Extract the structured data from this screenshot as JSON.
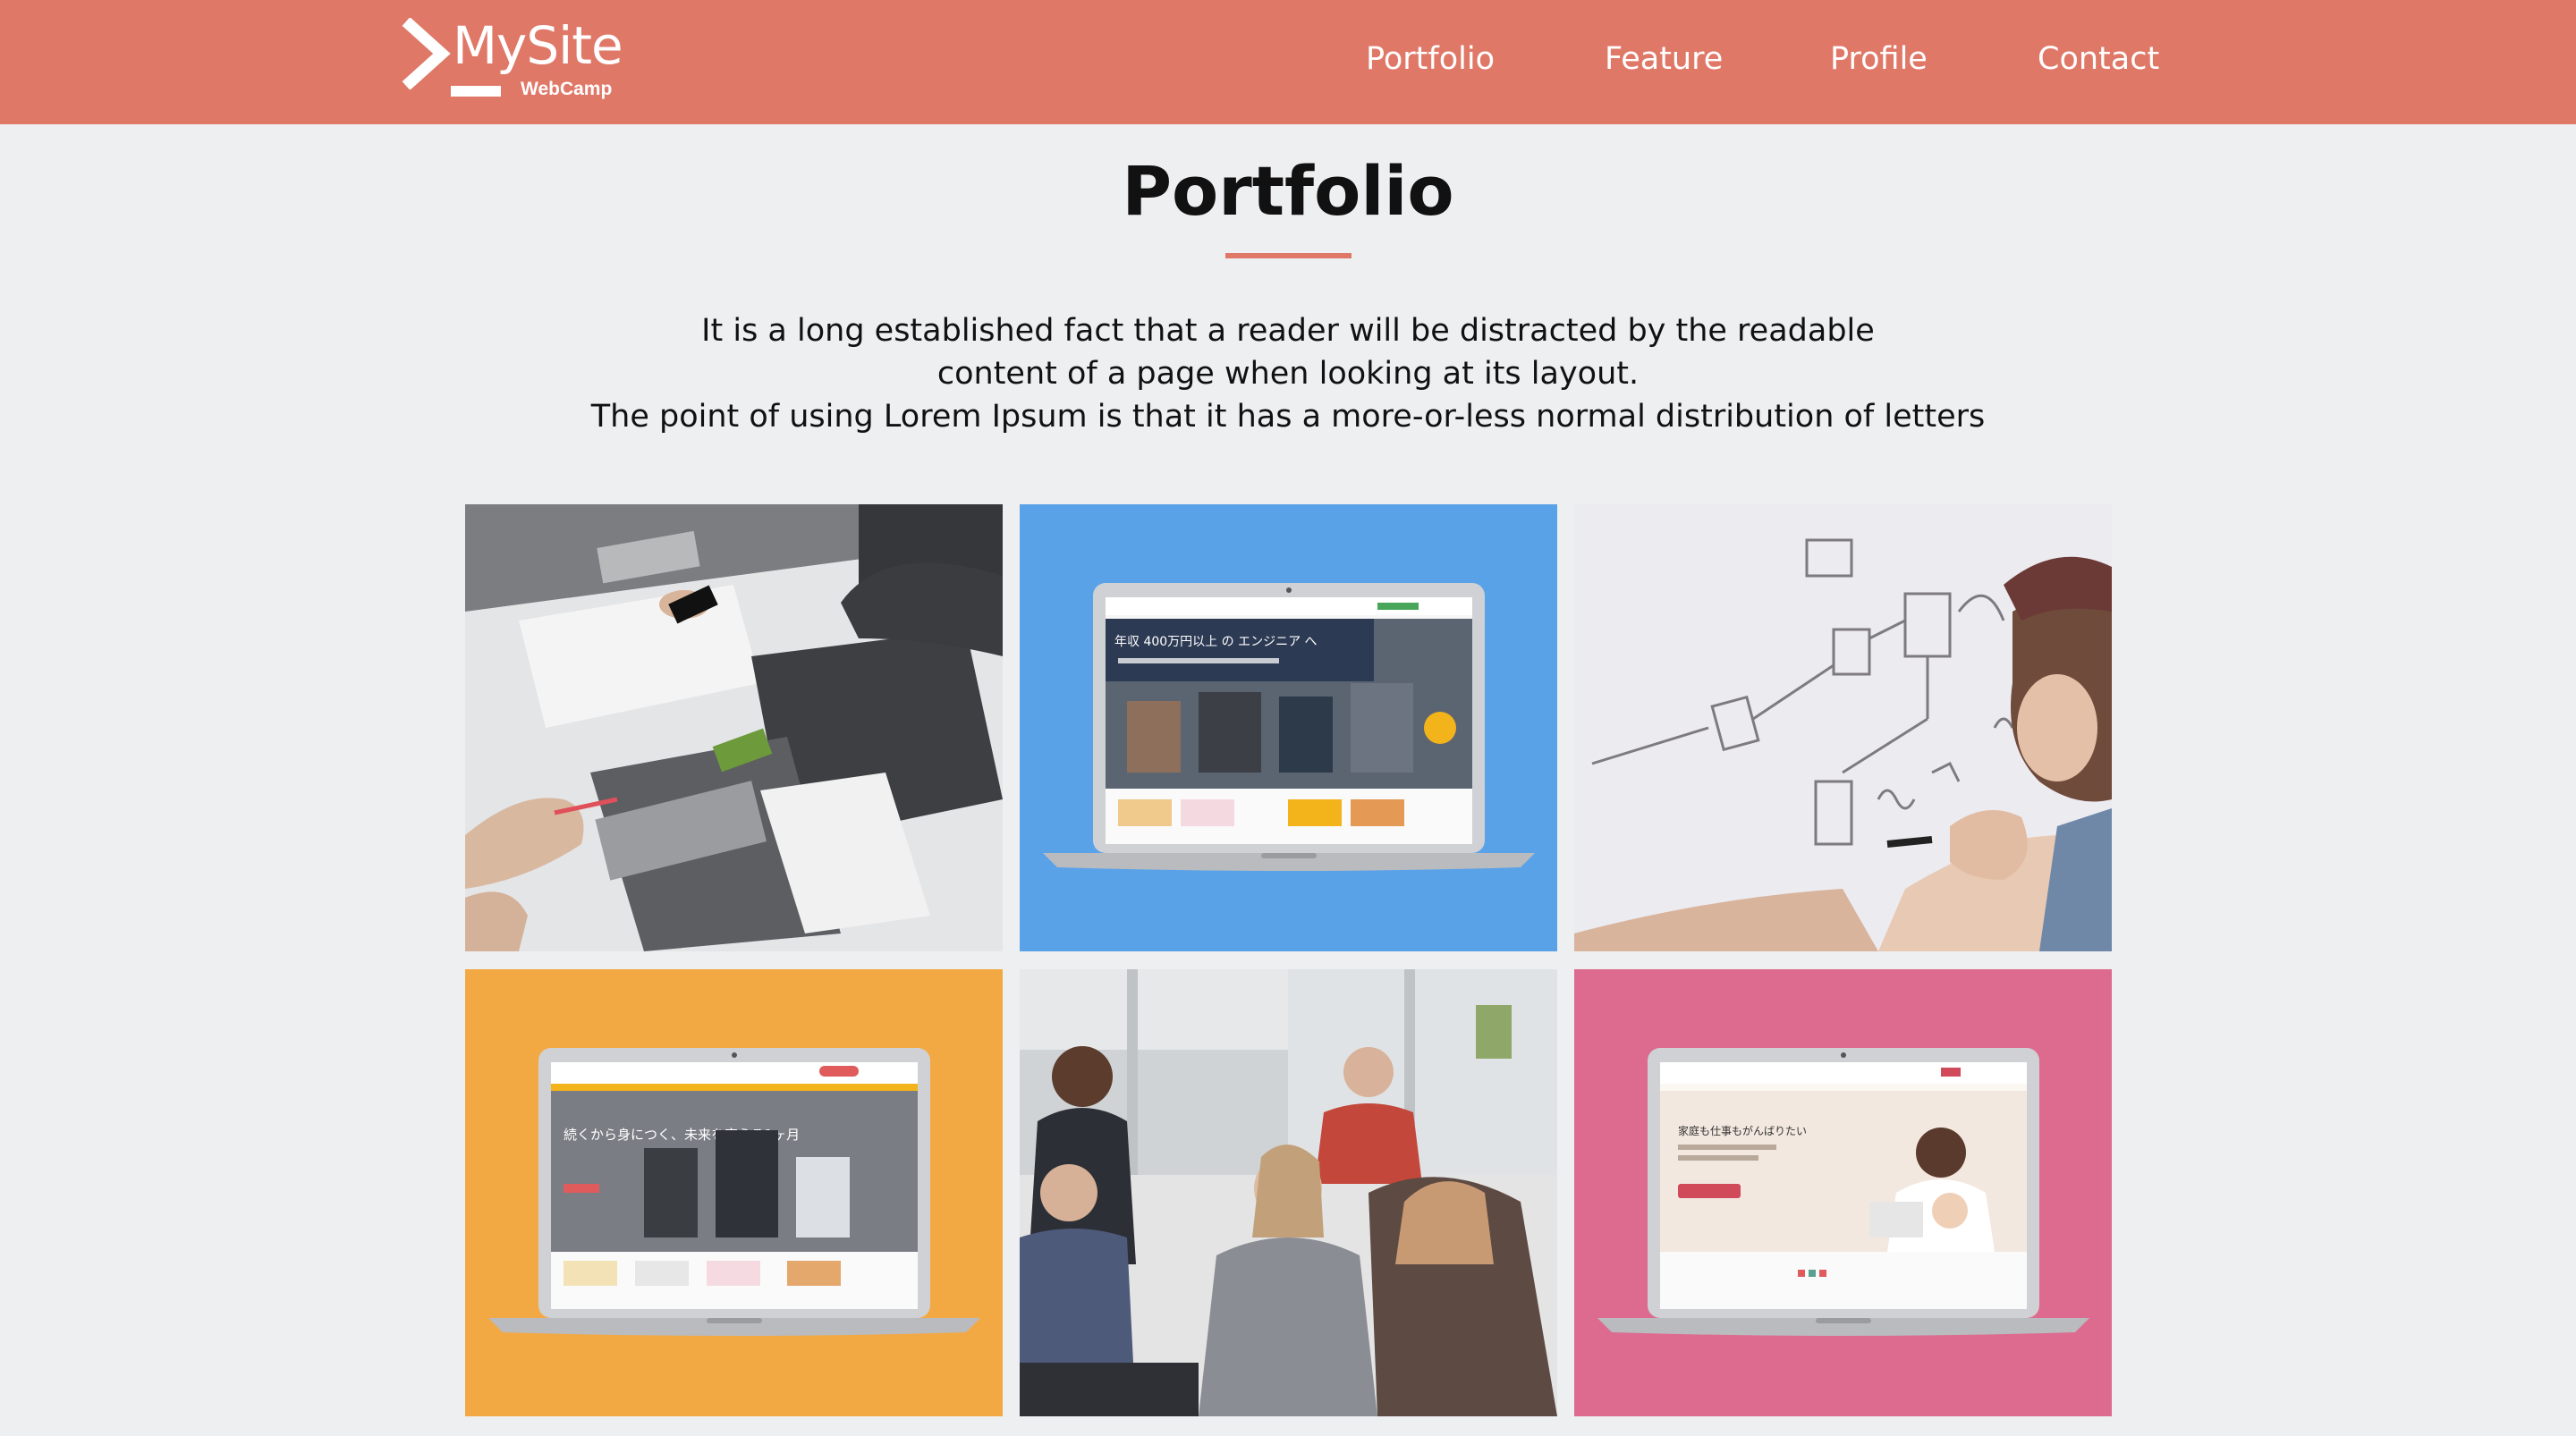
{
  "header": {
    "logo": {
      "title": "MySite",
      "subtitle": "WebCamp"
    },
    "nav": [
      {
        "label": "Portfolio"
      },
      {
        "label": "Feature"
      },
      {
        "label": "Profile"
      },
      {
        "label": "Contact"
      }
    ]
  },
  "main": {
    "title": "Portfolio",
    "intro": [
      "It is a long established fact that a reader will be distracted by the readable",
      "content of a page when looking at its layout.",
      "The point of using Lorem Ipsum is that it has a more-or-less normal distribution of letters"
    ]
  },
  "colors": {
    "brand": "#e07868",
    "background": "#eeeff1",
    "tile_blue": "#5aa2e8",
    "tile_orange": "#f2a944",
    "tile_pink": "#dd6b8f"
  },
  "portfolio": {
    "tiles": [
      {
        "icon": "photo-desk-newspapers"
      },
      {
        "icon": "laptop-mockup-blue",
        "screen_headline": "年収 400万円以上 の エンジニア へ"
      },
      {
        "icon": "photo-whiteboard-drawing"
      },
      {
        "icon": "laptop-mockup-orange",
        "screen_headline": "続くから身につく、未来を変える1ヶ月"
      },
      {
        "icon": "photo-team-meeting"
      },
      {
        "icon": "laptop-mockup-pink",
        "screen_headline": "家庭も仕事もがんばりたい"
      }
    ]
  }
}
